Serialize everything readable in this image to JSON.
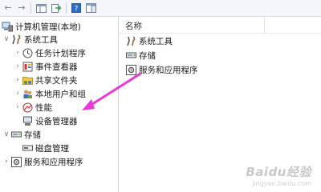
{
  "toolbar": {
    "buttons": [
      {
        "name": "back-icon",
        "glyph": "⇦"
      },
      {
        "name": "forward-icon",
        "glyph": "⇨"
      },
      {
        "name": "up-icon",
        "glyph": "▤"
      },
      {
        "name": "export-icon",
        "glyph": "⇲"
      },
      {
        "name": "help-icon",
        "glyph": "?"
      },
      {
        "name": "show-pane-icon",
        "glyph": "▣"
      }
    ]
  },
  "tree": {
    "root": "计算机管理(本地)",
    "system_tools": "系统工具",
    "task_scheduler": "任务计划程序",
    "event_viewer": "事件查看器",
    "shared_folders": "共享文件夹",
    "local_users": "本地用户和组",
    "performance": "性能",
    "device_manager": "设备管理器",
    "storage": "存储",
    "disk_management": "磁盘管理",
    "services_apps": "服务和应用程序"
  },
  "list": {
    "column_name": "名称",
    "items": [
      "系统工具",
      "存储",
      "服务和应用程序"
    ]
  },
  "watermark": {
    "top": "Baidu经验",
    "bottom": "jingyan.baidu.com"
  },
  "colors": {
    "annotation_arrow": "#e83ad6",
    "selection": "#e3ecf8"
  }
}
